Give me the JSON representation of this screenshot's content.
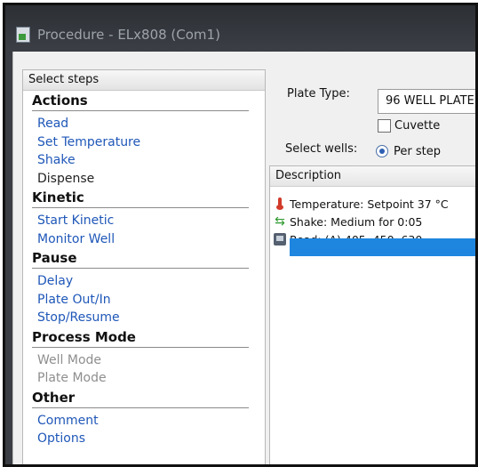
{
  "window": {
    "title": "Procedure - ELx808 (Com1)"
  },
  "steps_panel": {
    "header": "Select steps",
    "sections": [
      {
        "title": "Actions",
        "items": [
          {
            "label": "Read",
            "state": "enabled"
          },
          {
            "label": "Set Temperature",
            "state": "enabled"
          },
          {
            "label": "Shake",
            "state": "enabled"
          },
          {
            "label": "Dispense",
            "state": "plain"
          }
        ]
      },
      {
        "title": "Kinetic",
        "items": [
          {
            "label": "Start Kinetic",
            "state": "enabled"
          },
          {
            "label": "Monitor Well",
            "state": "enabled"
          }
        ]
      },
      {
        "title": "Pause",
        "items": [
          {
            "label": "Delay",
            "state": "enabled"
          },
          {
            "label": "Plate Out/In",
            "state": "enabled"
          },
          {
            "label": "Stop/Resume",
            "state": "enabled"
          }
        ]
      },
      {
        "title": "Process Mode",
        "items": [
          {
            "label": "Well Mode",
            "state": "disabled"
          },
          {
            "label": "Plate Mode",
            "state": "disabled"
          }
        ]
      },
      {
        "title": "Other",
        "items": [
          {
            "label": "Comment",
            "state": "enabled"
          },
          {
            "label": "Options",
            "state": "enabled"
          }
        ]
      }
    ]
  },
  "settings": {
    "plate_type_label": "Plate Type:",
    "plate_type_value": "96 WELL PLATE",
    "cuvette_label": "Cuvette",
    "cuvette_checked": false,
    "select_wells_label": "Select wells:",
    "per_step_label": "Per step",
    "per_step_selected": true
  },
  "description": {
    "header": "Description",
    "rows": [
      {
        "icon": "thermometer-icon",
        "text": "Temperature:  Setpoint 37 °C"
      },
      {
        "icon": "shake-arrows-icon",
        "text": "Shake: Medium for 0:05"
      },
      {
        "icon": "plate-reader-icon",
        "text": "Read:  (A) 405, 450, 630"
      }
    ]
  },
  "colors": {
    "link_blue": "#1f57b8",
    "selection_blue": "#1f86e0",
    "disabled_gray": "#8e8e8e"
  }
}
